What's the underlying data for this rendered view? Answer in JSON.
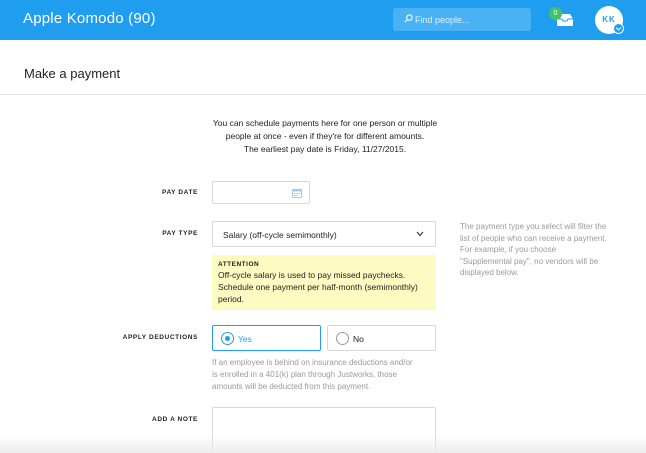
{
  "topbar": {
    "app_title": "Apple Komodo (90)",
    "search_placeholder": "Find people...",
    "inbox_count": "0",
    "avatar_initials": "KK",
    "colors": {
      "bar": "#1f9ef0",
      "badge": "#44c26a"
    },
    "icons": [
      "search-icon",
      "inbox-icon",
      "chevron-down-icon"
    ]
  },
  "page": {
    "title": "Make a payment"
  },
  "intro": {
    "line1": "You can schedule payments here for one person or multiple",
    "line2": "people at once - even if they're for different amounts.",
    "line3": "The earliest pay date is Friday, 11/27/2015."
  },
  "form": {
    "pay_date": {
      "label": "PAY DATE",
      "value": "",
      "icon": "calendar-icon"
    },
    "pay_type": {
      "label": "PAY TYPE",
      "selected": "Salary (off-cycle semimonthly)",
      "attention_title": "ATTENTION",
      "attention_line1": "Off-cycle salary is used to pay missed paychecks.",
      "attention_line2": "Schedule one payment per half-month (semimonthly)",
      "attention_line3": "period.",
      "side_note_line1": "The payment type you select will filter the",
      "side_note_line2": "list of people who can receive a payment.",
      "side_note_line3": "For example, if you choose",
      "side_note_line4": "\"Supplemental pay\", no vendors will be",
      "side_note_line5": "displayed below."
    },
    "apply_deductions": {
      "label": "APPLY DEDUCTIONS",
      "yes_label": "Yes",
      "no_label": "No",
      "selected": "Yes",
      "help_line1": "If an employee is behind on insurance deductions and/or",
      "help_line2": "is enrolled in a 401(k) plan through Justworks, those",
      "help_line3": "amounts will be deducted from this payment."
    },
    "note": {
      "label": "ADD A NOTE",
      "value": ""
    }
  }
}
